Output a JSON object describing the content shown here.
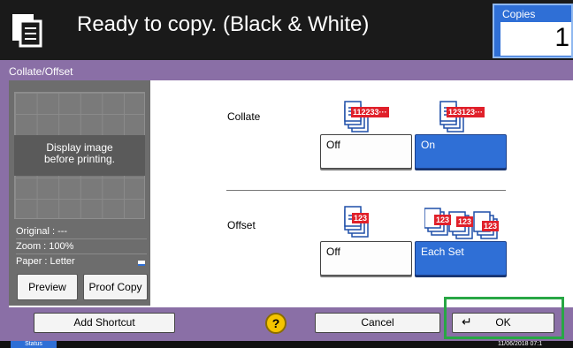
{
  "header": {
    "title": "Ready to copy. (Black & White)",
    "copies_label": "Copies",
    "copies_value": "1",
    "icon": "copy-function-icon"
  },
  "panel": {
    "title": "Collate/Offset"
  },
  "preview": {
    "message": "Display image\nbefore printing.",
    "original": "Original : ---",
    "zoom": "Zoom : 100%",
    "paper": "Paper : Letter",
    "preview_button": "Preview",
    "proof_copy_button": "Proof Copy"
  },
  "collate": {
    "label": "Collate",
    "off_label": "Off",
    "on_label": "On",
    "selected": "On",
    "off_badge": "112233···",
    "on_badge": "123123···"
  },
  "offset": {
    "label": "Offset",
    "off_label": "Off",
    "each_set_label": "Each Set",
    "selected": "Each Set",
    "badge": "123"
  },
  "bottom": {
    "add_shortcut": "Add Shortcut",
    "help": "?",
    "cancel": "Cancel",
    "ok": "OK"
  },
  "status": {
    "tab": "Status",
    "datetime": "11/06/2018 07:1"
  },
  "colors": {
    "accent_blue": "#2f6fd6",
    "frame_purple": "#8a6fa6",
    "highlight_green": "#28a745"
  }
}
